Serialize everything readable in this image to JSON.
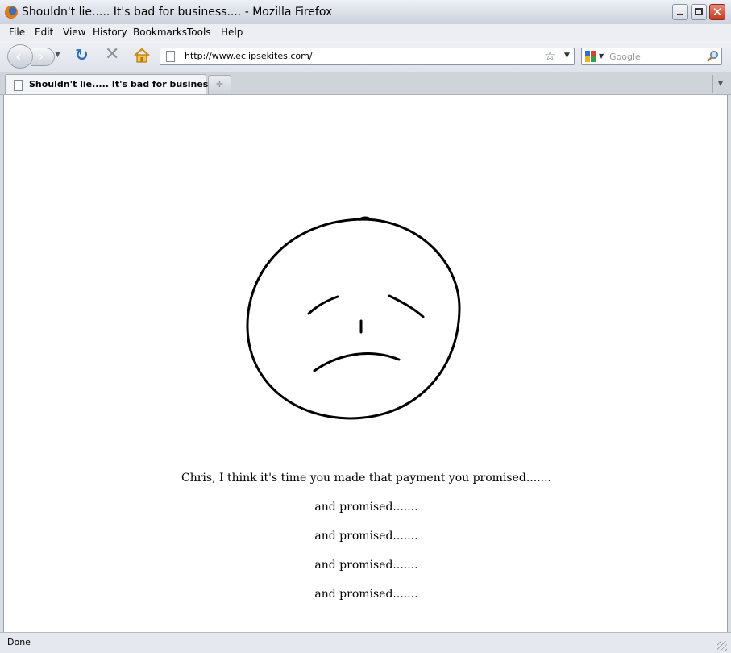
{
  "window": {
    "title": "Shouldn't lie..... It's bad for business.... - Mozilla Firefox"
  },
  "menubar": {
    "items": [
      {
        "label": "File"
      },
      {
        "label": "Edit"
      },
      {
        "label": "View"
      },
      {
        "label": "History"
      },
      {
        "label": "Bookmarks"
      },
      {
        "label": "Tools"
      },
      {
        "label": "Help"
      }
    ]
  },
  "navbar": {
    "url": "http://www.eclipsekites.com/",
    "search_placeholder": "Google"
  },
  "tabs": [
    {
      "label": "Shouldn't lie..... It's bad for business...."
    }
  ],
  "content": {
    "message": "Chris, I think it's time you made that payment you promised.......",
    "repeats": [
      "and promised.......",
      "and promised.......",
      "and promised.......",
      "and promised......."
    ]
  },
  "status": {
    "text": "Done"
  },
  "colors": {
    "accent": "#2e6fb8",
    "close_button": "#c2391f"
  }
}
